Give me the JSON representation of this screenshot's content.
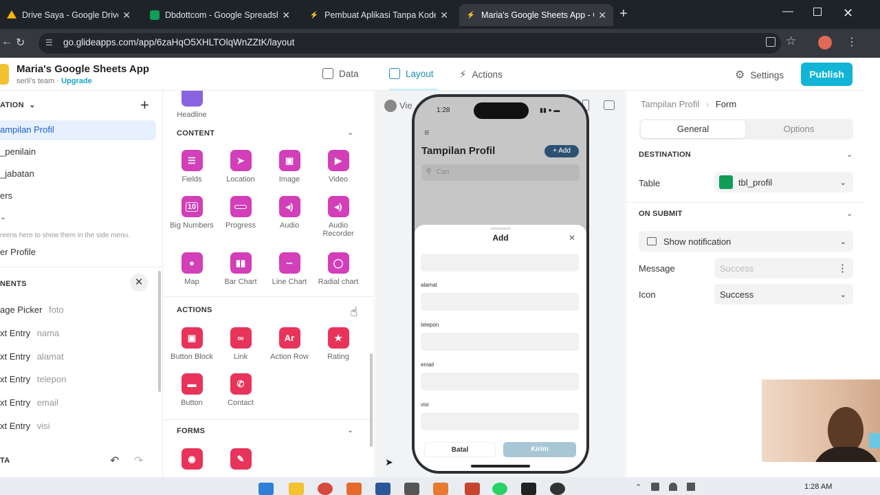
{
  "browser": {
    "tabs": [
      {
        "title": "Drive Saya - Google Drive",
        "close": "✕",
        "icon": "google-drive-icon",
        "color": "#f4b400"
      },
      {
        "title": "Dbdottcom - Google Spreadsh",
        "close": "✕",
        "icon": "google-sheets-icon",
        "color": "#0f9d58"
      },
      {
        "title": "Pembuat Aplikasi Tanpa Kode: I",
        "close": "✕",
        "icon": "glide-icon",
        "color": "#ffffff"
      },
      {
        "title": "Maria's Google Sheets App - Gl",
        "close": "✕",
        "icon": "glide-icon",
        "color": "#ffffff"
      }
    ],
    "new_tab": "+",
    "url": "go.glideapps.com/app/6zaHqO5XHLTOlqWnZZtK/layout"
  },
  "app": {
    "name": "Maria's Google Sheets App",
    "team": "serli's team",
    "team_sep": "·",
    "upgrade": "Upgrade",
    "nav": [
      {
        "label": "Data",
        "icon": "table-icon"
      },
      {
        "label": "Layout",
        "icon": "layout-icon"
      },
      {
        "label": "Actions",
        "icon": "lightning-icon"
      }
    ],
    "settings": "Settings",
    "publish": "Publish"
  },
  "left_panel": {
    "nav_header": "ATION",
    "screens": [
      "ampilan Profil",
      "_penilain",
      "_jabatan",
      "ers"
    ],
    "hint": "reens here to show them in the side menu.",
    "extra_screen": "er Profile",
    "components_header": "NENTS",
    "components": [
      {
        "type": "age Picker",
        "col": "foto"
      },
      {
        "type": "xt Entry",
        "col": "nama"
      },
      {
        "type": "xt Entry",
        "col": "alamat"
      },
      {
        "type": "xt Entry",
        "col": "telepon"
      },
      {
        "type": "xt Entry",
        "col": "email"
      },
      {
        "type": "xt Entry",
        "col": "visi"
      }
    ],
    "data_header": "TA"
  },
  "components_panel": {
    "top_item": "Headline",
    "content_header": "CONTENT",
    "content": [
      "Fields",
      "Location",
      "Image",
      "Video",
      "Big Numbers",
      "Progress",
      "Audio",
      "Audio Recorder",
      "Map",
      "Bar Chart",
      "Line Chart",
      "Radial chart"
    ],
    "big_number_glyph": "10",
    "actions_header": "ACTIONS",
    "actions": [
      "Button Block",
      "Link",
      "Action Row",
      "Rating",
      "Button",
      "Contact"
    ],
    "action_row_glyph": "Ar",
    "forms_header": "FORMS",
    "accent": "#d23fb8",
    "red_accent": "#e8345a"
  },
  "preview": {
    "view_label": "View",
    "time": "1:28",
    "screen_title": "Tampilan Profil",
    "add_button": "+ Add",
    "search_placeholder": "Cari",
    "modal_title": "Add",
    "fields": [
      "alamat",
      "telepon",
      "email",
      "visi"
    ],
    "cancel": "Batal",
    "submit": "Kirim"
  },
  "right_panel": {
    "breadcrumb": [
      "Tampilan Profil",
      "Form"
    ],
    "breadcrumb_sep": "›",
    "tabs": [
      "General",
      "Options"
    ],
    "destination_header": "DESTINATION",
    "table_label": "Table",
    "table_value": "tbl_profil",
    "on_submit_header": "ON SUBMIT",
    "on_submit_value": "Show notification",
    "message_label": "Message",
    "message_placeholder": "Success",
    "icon_label": "Icon",
    "icon_value": "Success"
  },
  "taskbar": {
    "time": "1:28 AM"
  }
}
